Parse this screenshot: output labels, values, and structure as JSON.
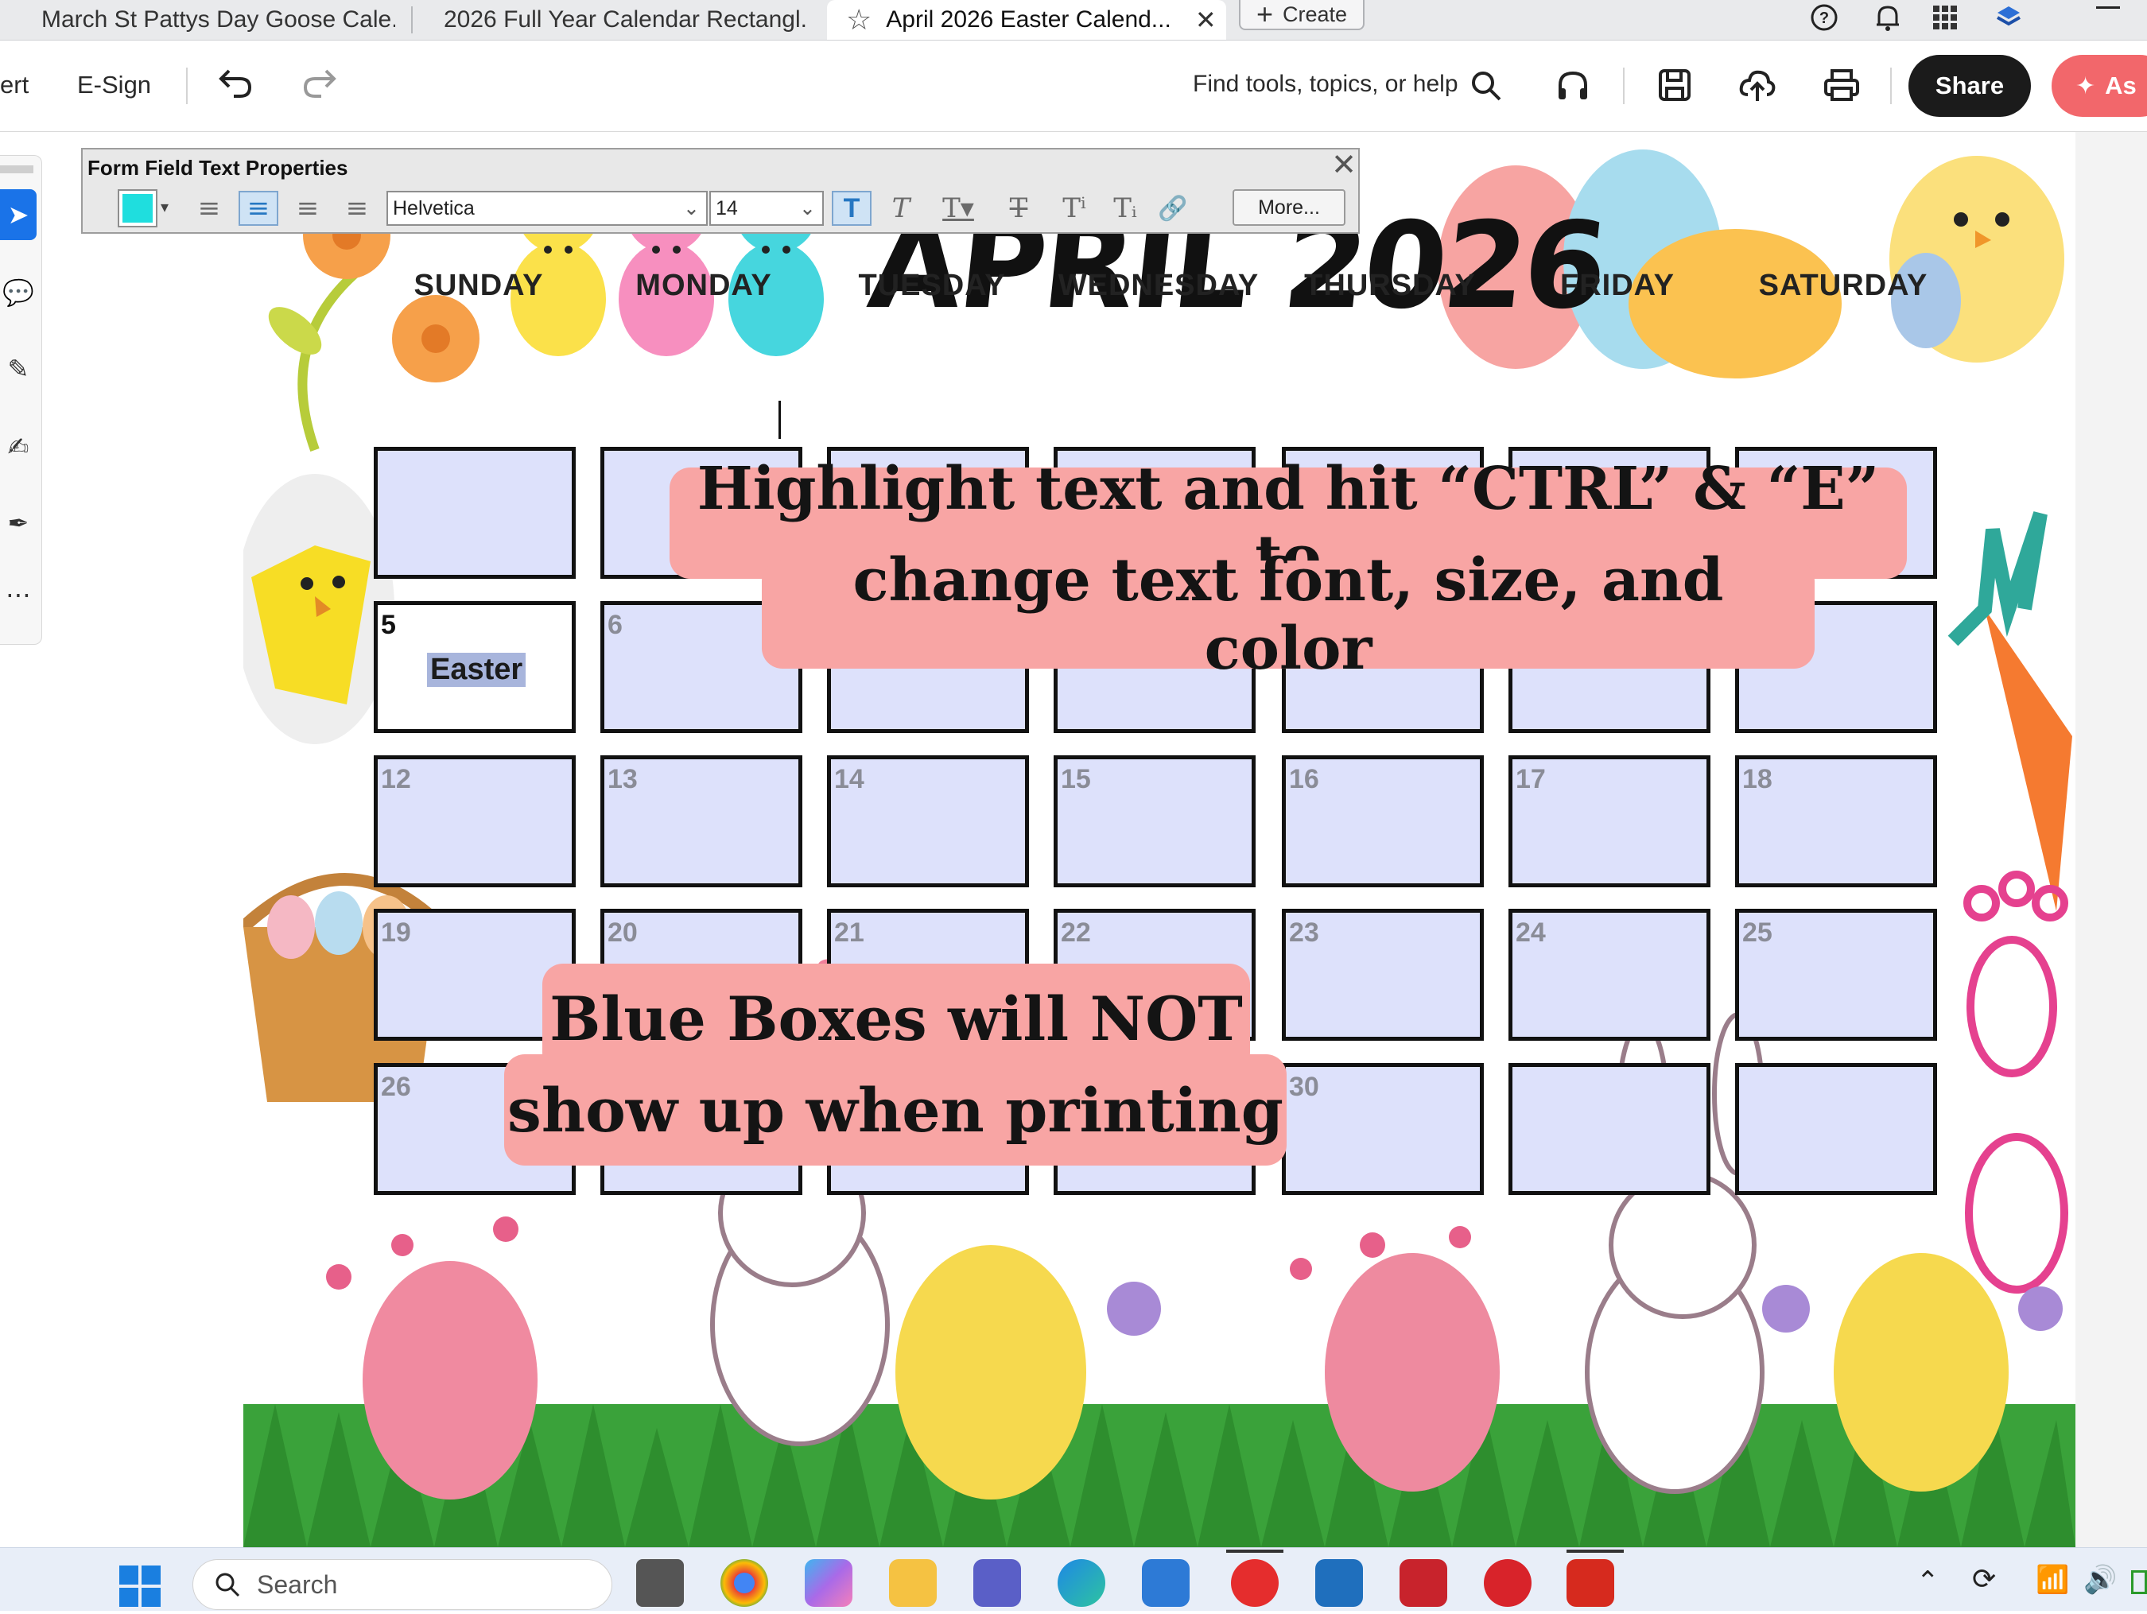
{
  "browser_tabs": [
    {
      "label": "March St Pattys Day Goose Cale..."
    },
    {
      "label": "2026 Full Year Calendar Rectangl..."
    },
    {
      "label": "April 2026 Easter Calend..."
    }
  ],
  "create_label": "Create",
  "toolbar": {
    "convert_label": "ert",
    "esign_label": "E-Sign",
    "search_label": "Find tools, topics, or help",
    "share_label": "Share",
    "assistant_label": "As"
  },
  "form_props": {
    "title": "Form Field Text Properties",
    "fill_color": "#1fdede",
    "font": "Helvetica",
    "size": "14",
    "more_label": "More..."
  },
  "calendar": {
    "title": "APRIL 2026",
    "days": [
      "SUNDAY",
      "MONDAY",
      "TUESDAY",
      "WEDNESDAY",
      "THURSDAY",
      "FRIDAY",
      "SATURDAY"
    ],
    "rows": [
      [
        "",
        "",
        "",
        "",
        "",
        "",
        ""
      ],
      [
        "5",
        "6",
        "",
        "",
        "",
        "",
        ""
      ],
      [
        "12",
        "13",
        "14",
        "15",
        "16",
        "17",
        "18"
      ],
      [
        "19",
        "20",
        "21",
        "22",
        "23",
        "24",
        "25"
      ],
      [
        "26",
        "",
        "",
        "",
        "30",
        "",
        ""
      ]
    ],
    "event_label": "Easter"
  },
  "callouts": {
    "top_line1": "Highlight text and hit “CTRL” & “E” to",
    "top_line2": "change text font, size, and color",
    "bottom_line1": "Blue Boxes will NOT",
    "bottom_line2": "show up when printing"
  },
  "taskbar": {
    "search_placeholder": "Search"
  },
  "colors": {
    "cell_blue": "#dde1fb",
    "callout_pink": "#f8a5a4",
    "share_black": "#1b1b1b",
    "assistant_red": "#f2676b"
  }
}
